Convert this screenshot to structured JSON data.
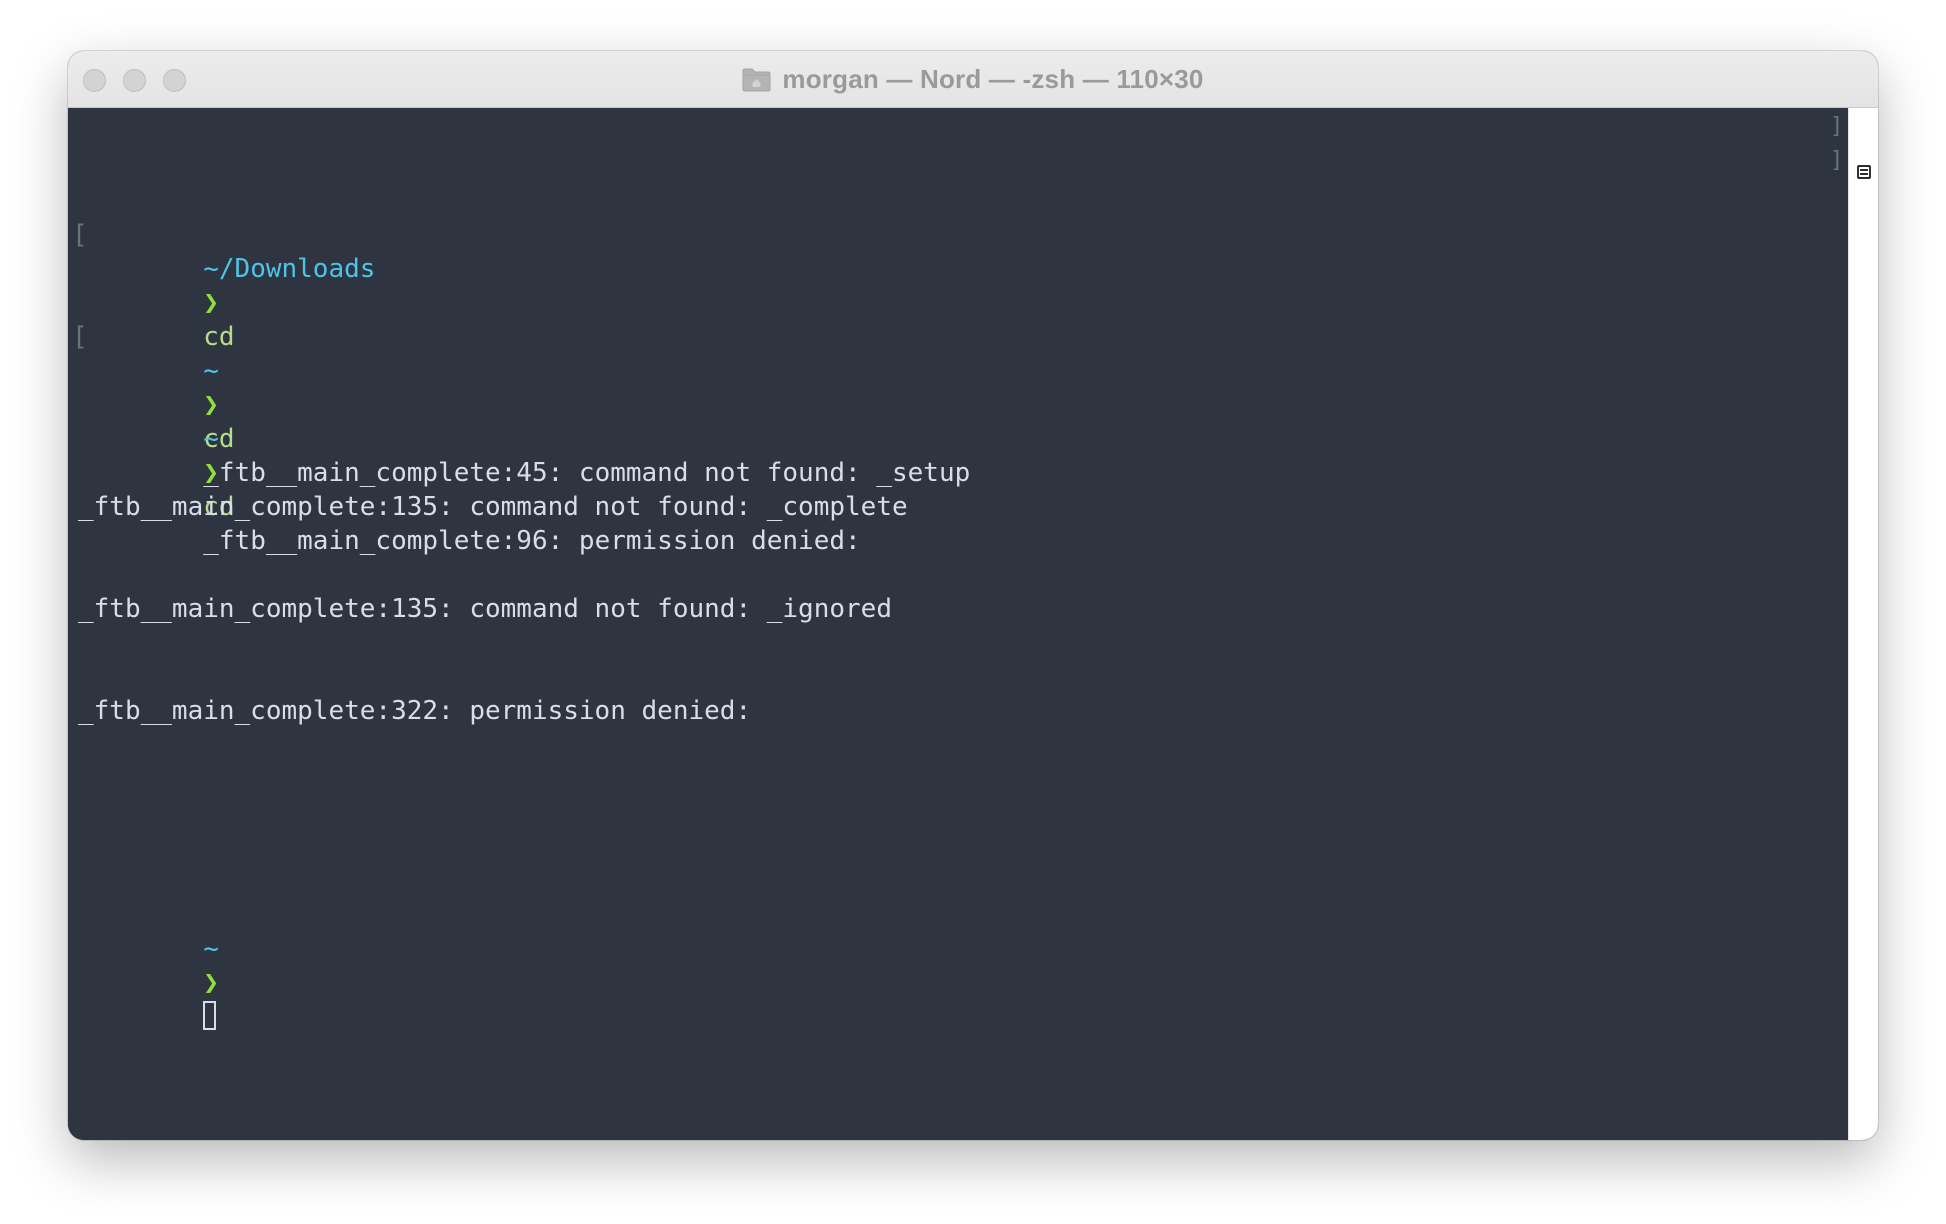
{
  "window": {
    "title": "morgan — Nord — -zsh — 110×30"
  },
  "terminal": {
    "line1": {
      "path": "~/Downloads",
      "arrow": "❯",
      "command": "cd"
    },
    "line2": {
      "path": "~",
      "arrow": "❯",
      "command": "cd",
      "output": "_ftb__main_complete:45: command not found: _setup"
    },
    "line3": {
      "path": "~",
      "arrow": "❯",
      "command": "cd",
      "output": "_ftb__main_complete:96: permission denied:"
    },
    "output_lines": [
      "_ftb__main_complete:135: command not found: _complete",
      "_ftb__main_complete:135: command not found: _ignored",
      "_ftb__main_complete:322: permission denied:"
    ],
    "prompt": {
      "path": "~",
      "arrow": "❯"
    }
  },
  "colors": {
    "background": "#2e3440",
    "foreground": "#d8dee9",
    "path": "#4fc3e8",
    "arrow": "#8ee03a",
    "command": "#b5dc8a"
  },
  "icons": {
    "title_icon": "folder-home-icon",
    "scrollbar_icon": "marks-list-icon"
  }
}
